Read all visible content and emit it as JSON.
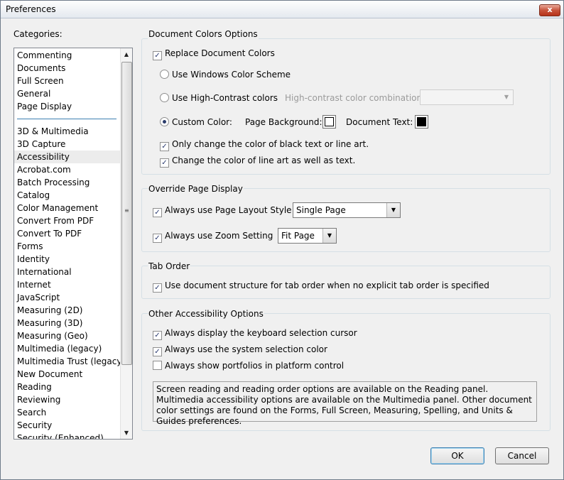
{
  "window": {
    "title": "Preferences",
    "close_label": "x"
  },
  "categories": {
    "label": "Categories:",
    "top_items": [
      "Commenting",
      "Documents",
      "Full Screen",
      "General",
      "Page Display"
    ],
    "items": [
      "3D & Multimedia",
      "3D Capture",
      "Accessibility",
      "Acrobat.com",
      "Batch Processing",
      "Catalog",
      "Color Management",
      "Convert From PDF",
      "Convert To PDF",
      "Forms",
      "Identity",
      "International",
      "Internet",
      "JavaScript",
      "Measuring (2D)",
      "Measuring (3D)",
      "Measuring (Geo)",
      "Multimedia (legacy)",
      "Multimedia Trust (legacy)",
      "New Document",
      "Reading",
      "Reviewing",
      "Search",
      "Security",
      "Security (Enhanced)"
    ],
    "selected": "Accessibility"
  },
  "document_colors": {
    "title": "Document Colors Options",
    "replace_colors": {
      "label": "Replace Document Colors",
      "checked": true
    },
    "use_windows_scheme": {
      "label": "Use Windows Color Scheme",
      "selected": false
    },
    "use_high_contrast": {
      "label": "Use High-Contrast colors",
      "selected": false
    },
    "high_contrast_combo_label": "High-contrast color combination:",
    "custom_color": {
      "label": "Custom Color:",
      "selected": true
    },
    "page_background_label": "Page Background:",
    "page_background_color": "#ffffff",
    "document_text_label": "Document Text:",
    "document_text_color": "#000000",
    "only_black_text": {
      "label": "Only change the color of black text or line art.",
      "checked": true
    },
    "change_line_art": {
      "label": "Change the color of line art as well as text.",
      "checked": true
    }
  },
  "override_page_display": {
    "title": "Override Page Display",
    "page_layout": {
      "label": "Always use Page Layout Style",
      "checked": true,
      "value": "Single Page"
    },
    "zoom_setting": {
      "label": "Always use Zoom Setting",
      "checked": true,
      "value": "Fit Page"
    }
  },
  "tab_order": {
    "title": "Tab Order",
    "use_structure": {
      "label": "Use document structure for tab order when no explicit tab order is specified",
      "checked": true
    }
  },
  "other_options": {
    "title": "Other Accessibility Options",
    "keyboard_cursor": {
      "label": "Always display the keyboard selection cursor",
      "checked": true
    },
    "system_selection_color": {
      "label": "Always use the system selection color",
      "checked": true
    },
    "portfolios_platform": {
      "label": "Always show portfolios in platform control",
      "checked": false
    },
    "note": "Screen reading and reading order options are available on the Reading panel. Multimedia accessibility options are available on the Multimedia panel. Other document color settings are found on the Forms, Full Screen, Measuring, Spelling, and Units & Guides preferences."
  },
  "buttons": {
    "ok": "OK",
    "cancel": "Cancel"
  },
  "icons": {
    "check": "✓",
    "arrow_down": "▼",
    "arrow_up": "▲",
    "grip": "≡"
  }
}
